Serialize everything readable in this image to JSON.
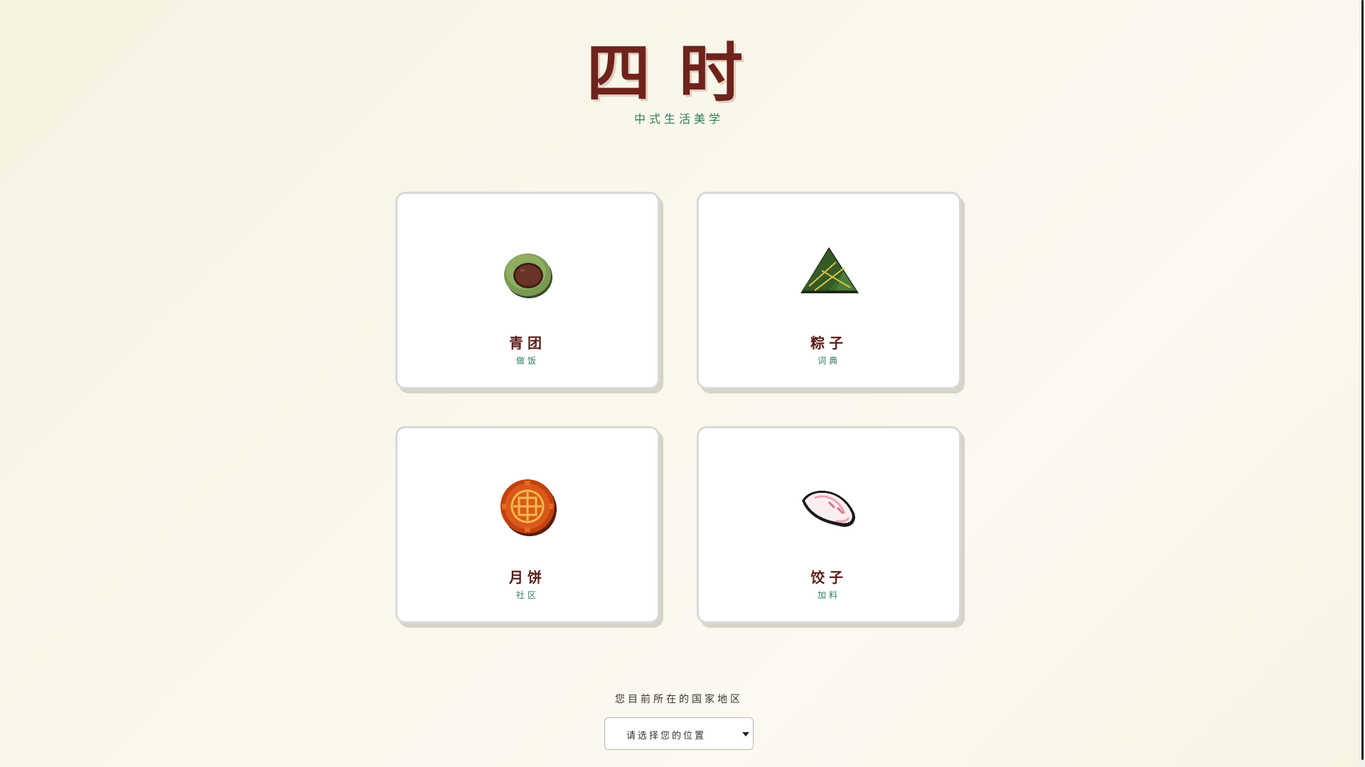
{
  "header": {
    "title": "四时",
    "subtitle": "中式生活美学"
  },
  "cards": [
    {
      "name": "青团",
      "subtitle": "做饭",
      "icon": "qingtuan-icon"
    },
    {
      "name": "粽子",
      "subtitle": "词典",
      "icon": "zongzi-icon"
    },
    {
      "name": "月饼",
      "subtitle": "社区",
      "icon": "mooncake-icon"
    },
    {
      "name": "饺子",
      "subtitle": "加料",
      "icon": "dumpling-icon"
    }
  ],
  "region": {
    "label": "您目前所在的国家地区",
    "select_value": "请选择您的位置"
  },
  "colors": {
    "title": "#6e241c",
    "accent_green": "#2f7a5c",
    "background": "#f8f6e6"
  }
}
